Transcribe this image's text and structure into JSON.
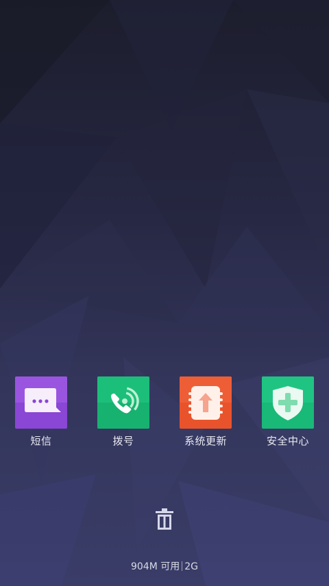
{
  "apps": [
    {
      "name": "sms",
      "label": "短信",
      "icon": "message-icon",
      "color": "#8a46d4"
    },
    {
      "name": "dialer",
      "label": "拨号",
      "icon": "phone-icon",
      "color": "#17b26f"
    },
    {
      "name": "system-update",
      "label": "系统更新",
      "icon": "update-icon",
      "color": "#e9532c"
    },
    {
      "name": "security-center",
      "label": "安全中心",
      "icon": "shield-icon",
      "color": "#19b978"
    }
  ],
  "clear_button": {
    "icon": "trash-icon"
  },
  "memory": {
    "available": "904M 可用",
    "total": "2G"
  }
}
